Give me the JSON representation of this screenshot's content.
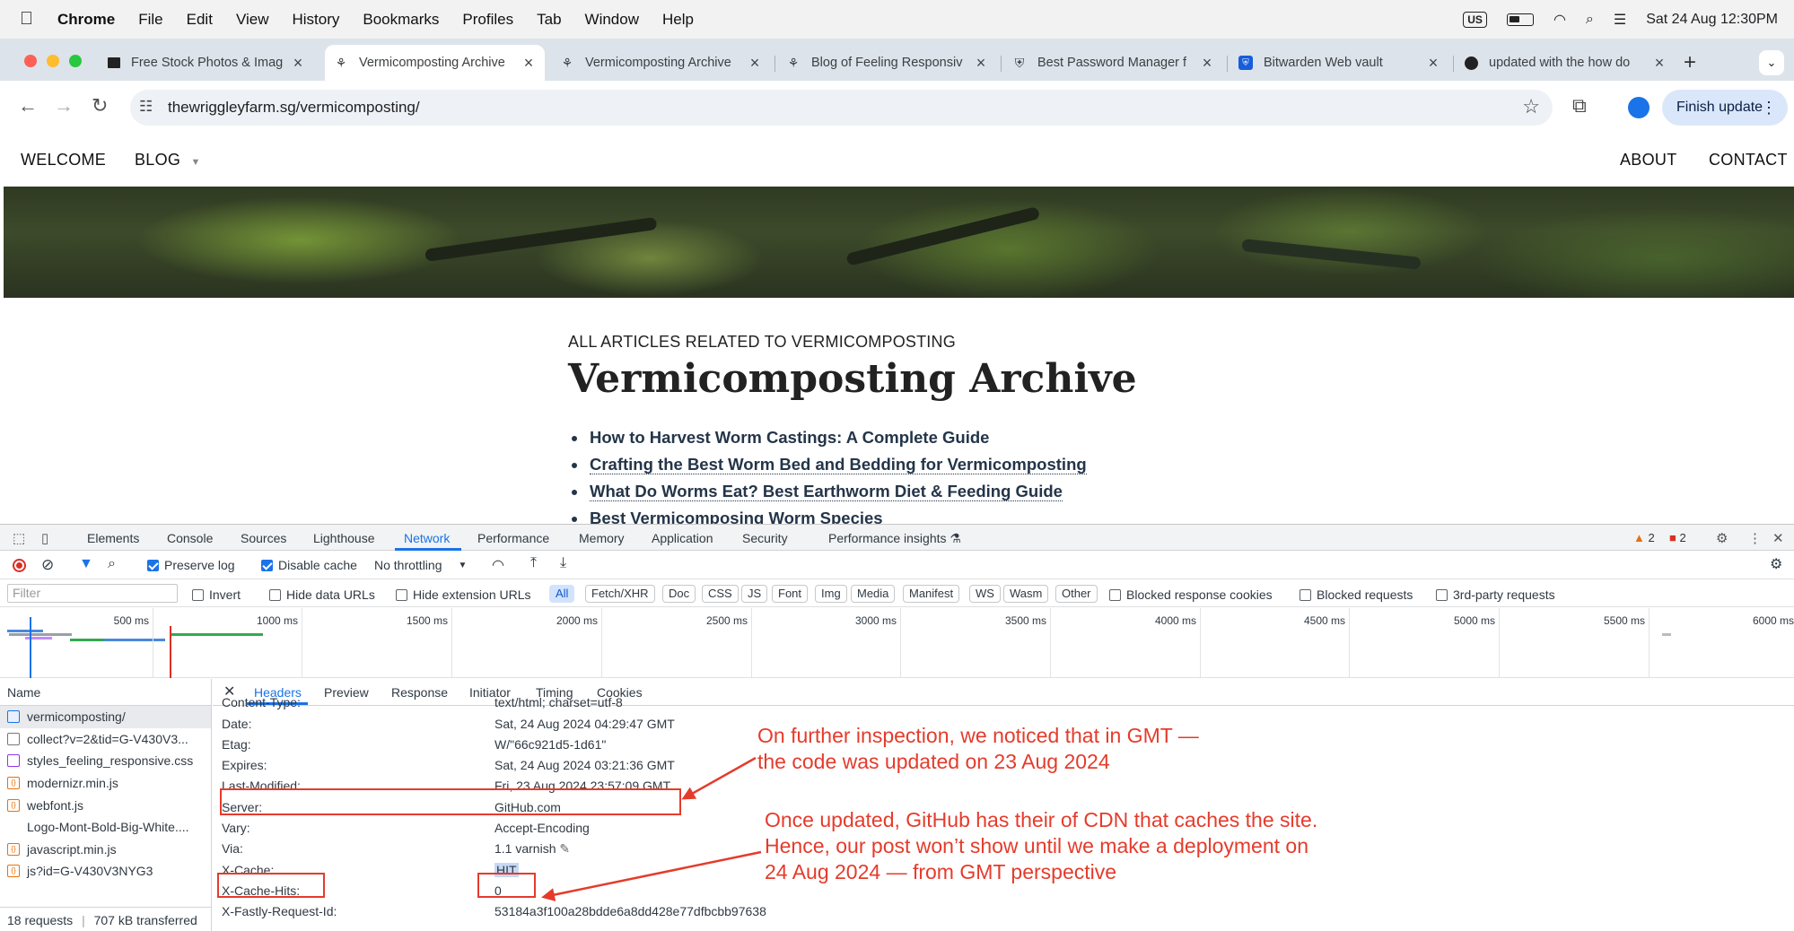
{
  "menubar": {
    "app": "Chrome",
    "items": [
      "File",
      "Edit",
      "View",
      "History",
      "Bookmarks",
      "Profiles",
      "Tab",
      "Window",
      "Help"
    ],
    "input_source": "US",
    "datetime": "Sat 24 Aug  12:30PM"
  },
  "tabs": [
    {
      "title": "Free Stock Photos & Imag",
      "favicon": "unsplash-icon"
    },
    {
      "title": "Vermicomposting Archive",
      "favicon": "site-icon",
      "active": true
    },
    {
      "title": "Vermicomposting Archive",
      "favicon": "site-icon"
    },
    {
      "title": "Blog of Feeling Responsiv",
      "favicon": "site-icon"
    },
    {
      "title": "Best Password Manager f",
      "favicon": "shield-icon"
    },
    {
      "title": "Bitwarden Web vault",
      "favicon": "bitwarden-icon"
    },
    {
      "title": "updated with the how do",
      "favicon": "github-icon"
    }
  ],
  "omnibox": {
    "url": "thewriggleyfarm.sg/vermicomposting/"
  },
  "finish_update": "Finish update",
  "site_nav": {
    "welcome": "WELCOME",
    "blog": "BLOG",
    "about": "ABOUT",
    "contact": "CONTACT"
  },
  "page": {
    "kicker": "ALL ARTICLES RELATED TO VERMICOMPOSTING",
    "title": "Vermicomposting Archive",
    "posts": [
      "How to Harvest Worm Castings: A Complete Guide",
      "Crafting the Best Worm Bed and Bedding for Vermicomposting",
      "What Do Worms Eat? Best Earthworm Diet & Feeding Guide",
      "Best Vermicomposing Worm Species"
    ]
  },
  "devtools": {
    "tabs": [
      "Elements",
      "Console",
      "Sources",
      "Lighthouse",
      "Network",
      "Performance",
      "Memory",
      "Application",
      "Security",
      "Performance insights"
    ],
    "active_tab": "Network",
    "warnings": "2",
    "errors": "2",
    "toolbar": {
      "preserve_log": "Preserve log",
      "disable_cache": "Disable cache",
      "throttling": "No throttling"
    },
    "filter": {
      "placeholder": "Filter",
      "invert": "Invert",
      "hide_data_urls": "Hide data URLs",
      "hide_extension_urls": "Hide extension URLs",
      "types": [
        "All",
        "Fetch/XHR",
        "Doc",
        "CSS",
        "JS",
        "Font",
        "Img",
        "Media",
        "Manifest",
        "WS",
        "Wasm",
        "Other"
      ],
      "blocked_response_cookies": "Blocked response cookies",
      "blocked_requests": "Blocked requests",
      "third_party": "3rd-party requests"
    },
    "timeline_labels": [
      "500 ms",
      "1000 ms",
      "1500 ms",
      "2000 ms",
      "2500 ms",
      "3000 ms",
      "3500 ms",
      "4000 ms",
      "4500 ms",
      "5000 ms",
      "5500 ms",
      "6000 ms"
    ],
    "requests": {
      "header": "Name",
      "rows": [
        {
          "name": "vermicomposting/",
          "type": "doc"
        },
        {
          "name": "collect?v=2&tid=G-V430V3...",
          "type": "none"
        },
        {
          "name": "styles_feeling_responsive.css",
          "type": "css"
        },
        {
          "name": "modernizr.min.js",
          "type": "js"
        },
        {
          "name": "webfont.js",
          "type": "js"
        },
        {
          "name": "Logo-Mont-Bold-Big-White....",
          "type": "none"
        },
        {
          "name": "javascript.min.js",
          "type": "js"
        },
        {
          "name": "js?id=G-V430V3NYG3",
          "type": "js"
        }
      ],
      "footer_count": "18 requests",
      "footer_size": "707 kB transferred"
    },
    "detail_tabs": [
      "Headers",
      "Preview",
      "Response",
      "Initiator",
      "Timing",
      "Cookies"
    ],
    "headers": [
      {
        "name": "Content-Type:",
        "value": "text/html; charset=utf-8"
      },
      {
        "name": "Date:",
        "value": "Sat, 24 Aug 2024 04:29:47 GMT"
      },
      {
        "name": "Etag:",
        "value": "W/\"66c921d5-1d61\""
      },
      {
        "name": "Expires:",
        "value": "Sat, 24 Aug 2024 03:21:36 GMT"
      },
      {
        "name": "Last-Modified:",
        "value": "Fri, 23 Aug 2024 23:57:09 GMT"
      },
      {
        "name": "Server:",
        "value": "GitHub.com"
      },
      {
        "name": "Vary:",
        "value": "Accept-Encoding"
      },
      {
        "name": "Via:",
        "value": "1.1 varnish"
      },
      {
        "name": "X-Cache:",
        "value": "HIT"
      },
      {
        "name": "X-Cache-Hits:",
        "value": "0"
      },
      {
        "name": "X-Fastly-Request-Id:",
        "value": "53184a3f100a28bdde6a8dd428e77dfbcbb97638"
      }
    ]
  },
  "annotations": {
    "note1": [
      "On further inspection, we noticed that in GMT —",
      "the code was updated on 23 Aug 2024"
    ],
    "note2": [
      "Once updated, GitHub has their of CDN that caches the site.",
      "Hence, our post won’t show until we make a deployment on",
      "24 Aug 2024 — from GMT perspective"
    ],
    "color": "#e53b2b"
  },
  "colors": {
    "accent": "#1a73e8",
    "annotation": "#e53b2b",
    "link": "#243549"
  }
}
